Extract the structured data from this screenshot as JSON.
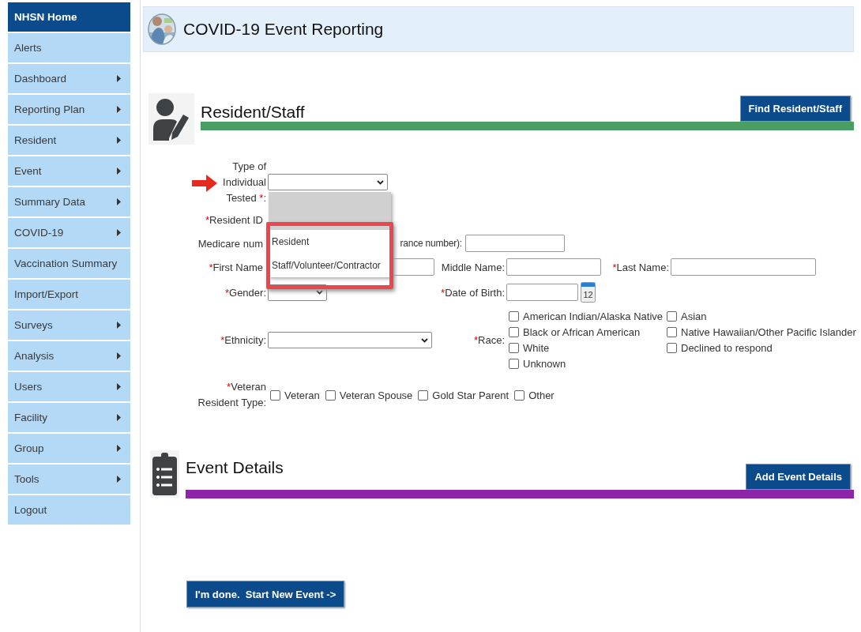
{
  "sidebar": {
    "items": [
      {
        "label": "NHSN Home",
        "submenu": false,
        "selected": true
      },
      {
        "label": "Alerts",
        "submenu": false,
        "selected": false
      },
      {
        "label": "Dashboard",
        "submenu": true,
        "selected": false
      },
      {
        "label": "Reporting Plan",
        "submenu": true,
        "selected": false
      },
      {
        "label": "Resident",
        "submenu": true,
        "selected": false
      },
      {
        "label": "Event",
        "submenu": true,
        "selected": false
      },
      {
        "label": "Summary Data",
        "submenu": true,
        "selected": false
      },
      {
        "label": "COVID-19",
        "submenu": true,
        "selected": false
      },
      {
        "label": "Vaccination Summary",
        "submenu": false,
        "selected": false
      },
      {
        "label": "Import/Export",
        "submenu": false,
        "selected": false
      },
      {
        "label": "Surveys",
        "submenu": true,
        "selected": false
      },
      {
        "label": "Analysis",
        "submenu": true,
        "selected": false
      },
      {
        "label": "Users",
        "submenu": true,
        "selected": false
      },
      {
        "label": "Facility",
        "submenu": true,
        "selected": false
      },
      {
        "label": "Group",
        "submenu": true,
        "selected": false
      },
      {
        "label": "Tools",
        "submenu": true,
        "selected": false
      },
      {
        "label": "Logout",
        "submenu": false,
        "selected": false
      }
    ]
  },
  "header": {
    "title": "COVID-19 Event Reporting"
  },
  "resident_section": {
    "title": "Resident/Staff",
    "button": "Find Resident/Staff"
  },
  "form": {
    "type_field": {
      "label_lines": [
        "Type of",
        "Individual",
        "Tested"
      ],
      "mark": "*",
      "suffix": ":",
      "dropdown": {
        "blank_highlighted": true,
        "options": [
          {
            "label": "Resident"
          },
          {
            "label": "Staff/Volunteer/Contractor"
          }
        ]
      }
    },
    "resident_id": {
      "mark": "*",
      "label": "Resident ID"
    },
    "medicare": {
      "label_start": "Medicare num",
      "label_end": "rance number):"
    },
    "first_name": {
      "mark": "*",
      "label": "First Name"
    },
    "middle_name": {
      "label": "Middle Name:"
    },
    "last_name": {
      "mark": "*",
      "label": "Last Name:"
    },
    "gender": {
      "mark": "*",
      "label": "Gender:"
    },
    "date_of_birth": {
      "mark": "*",
      "label": "Date of Birth:",
      "calendar_day": "12"
    },
    "ethnicity": {
      "mark": "*",
      "label": "Ethnicity:"
    },
    "race": {
      "mark": "*",
      "label": "Race:",
      "options": [
        {
          "label": "American Indian/Alaska Native",
          "checked": false
        },
        {
          "label": "Asian",
          "checked": false
        },
        {
          "label": "Black or African American",
          "checked": false
        },
        {
          "label": "Native Hawaiian/Other Pacific Islander",
          "checked": false
        },
        {
          "label": "White",
          "checked": false
        },
        {
          "label": "Declined to respond",
          "checked": false
        },
        {
          "label": "Unknown",
          "checked": false
        }
      ]
    },
    "veteran": {
      "mark": "*",
      "label_lines": [
        "Veteran",
        "Resident Type:"
      ],
      "options": [
        {
          "label": "Veteran",
          "checked": false
        },
        {
          "label": "Veteran Spouse",
          "checked": false
        },
        {
          "label": "Gold Star Parent",
          "checked": false
        },
        {
          "label": "Other",
          "checked": false
        }
      ]
    }
  },
  "event_section": {
    "title": "Event Details",
    "button": "Add Event Details"
  },
  "footer_button": "I'm done.  Start New Event ->"
}
